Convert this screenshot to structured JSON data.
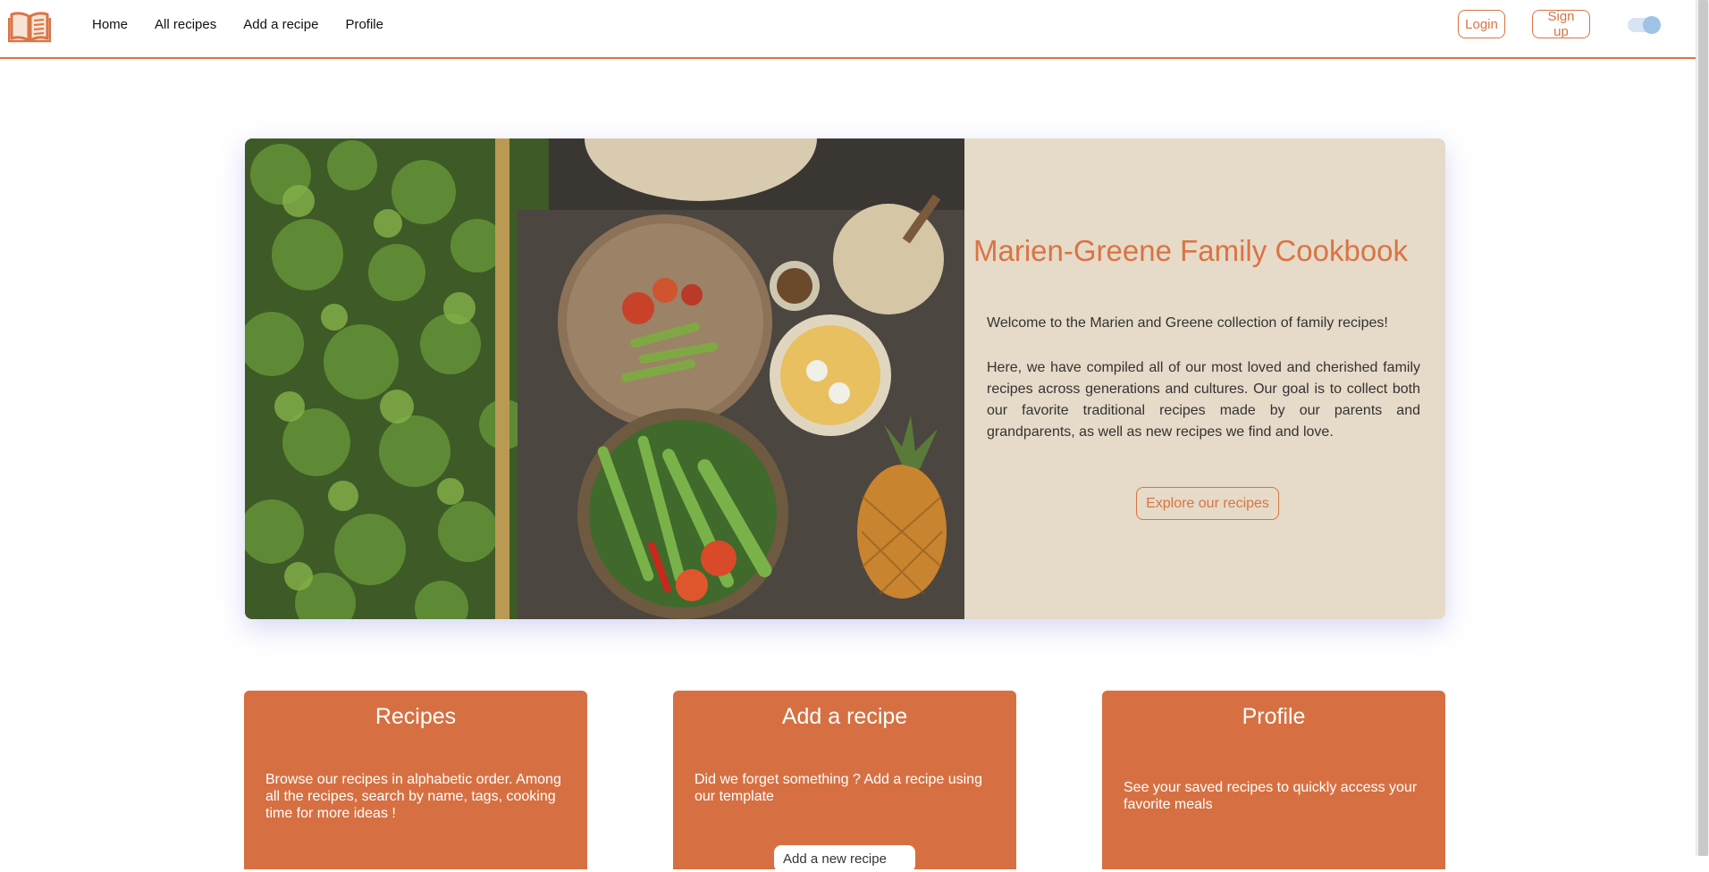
{
  "nav": {
    "logo_icon": "open-book-icon",
    "links": [
      "Home",
      "All recipes",
      "Add a recipe",
      "Profile"
    ],
    "login_label": "Login",
    "signup_label": "Sign up",
    "theme_toggle_on": true
  },
  "hero": {
    "image": "overhead photo of vegetables on a cutting board beside a garden",
    "title": "Marien-Greene Family Cookbook",
    "welcome": "Welcome to the Marien and Greene collection of family recipes!",
    "body": "Here, we have compiled all of our most loved and cherished family recipes across generations and cultures. Our goal is to collect both our favorite traditional recipes made by our parents and grandparents, as well as new recipes we find and love.",
    "cta_label": "Explore our recipes"
  },
  "cards": {
    "recipes": {
      "title": "Recipes",
      "text": "Browse our recipes in alphabetic order. Among all the recipes, search by name, tags, cooking time for more ideas !"
    },
    "add": {
      "title": "Add a recipe",
      "text": "Did we forget something ? Add a recipe using our template",
      "button_label": "Add a new recipe"
    },
    "profile": {
      "title": "Profile",
      "text": "See your saved recipes to quickly access your favorite meals"
    }
  },
  "colors": {
    "accent": "#d97444",
    "card_bg": "#d67042",
    "hero_panel_bg": "#e6dac8",
    "toggle": "#9fc3e6"
  }
}
